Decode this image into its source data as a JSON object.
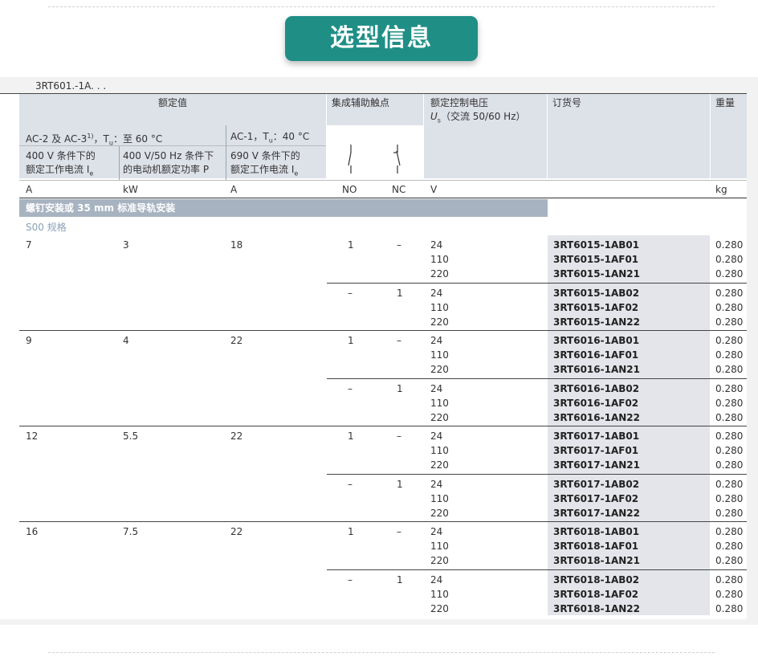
{
  "page_title": "选型信息",
  "series_code": "3RT601.-1A. . .",
  "header": {
    "rated_values": "额定值",
    "aux_contacts": "集成辅助触点",
    "control_voltage_line1": "额定控制电压",
    "control_voltage_line2": "U",
    "control_voltage_sub": "s",
    "control_voltage_line3": "（交流 50/60 Hz）",
    "order_no": "订货号",
    "weight": "重量",
    "ac2_label": "AC-2 及 AC-3",
    "ac2_sup": "1)",
    "ac2_tail": "，T",
    "ac2_tsub": "u",
    "ac2_temp": "：至 60 °C",
    "ac1_label": "AC-1，T",
    "ac1_tsub": "u",
    "ac1_temp": "：40 °C",
    "col1_line1": "400 V 条件下的",
    "col1_line2": "额定工作电流 I",
    "col1_sub": "e",
    "col2_line1": "400 V/50 Hz 条件下",
    "col2_line2": "的电动机额定功率 P",
    "col3_line1": "690 V 条件下的",
    "col3_line2": "额定工作电流 I",
    "col3_sub": "e",
    "unit_a1": "A",
    "unit_kw": "kW",
    "unit_a2": "A",
    "unit_no": "NO",
    "unit_nc": "NC",
    "unit_v": "V",
    "unit_kg": "kg"
  },
  "section_title": "螺钉安装或 35 mm 标准导轨安装",
  "size_label": "S00 规格",
  "groups": [
    {
      "current": "7",
      "power": "3",
      "ac1": "18",
      "rows": [
        {
          "no": "1",
          "nc": "–",
          "voltages": [
            "24",
            "110",
            "220"
          ],
          "orders": [
            "3RT6015-1AB01",
            "3RT6015-1AF01",
            "3RT6015-1AN21"
          ],
          "weights": [
            "0.280",
            "0.280",
            "0.280"
          ]
        },
        {
          "no": "–",
          "nc": "1",
          "voltages": [
            "24",
            "110",
            "220"
          ],
          "orders": [
            "3RT6015-1AB02",
            "3RT6015-1AF02",
            "3RT6015-1AN22"
          ],
          "weights": [
            "0.280",
            "0.280",
            "0.280"
          ]
        }
      ]
    },
    {
      "current": "9",
      "power": "4",
      "ac1": "22",
      "rows": [
        {
          "no": "1",
          "nc": "–",
          "voltages": [
            "24",
            "110",
            "220"
          ],
          "orders": [
            "3RT6016-1AB01",
            "3RT6016-1AF01",
            "3RT6016-1AN21"
          ],
          "weights": [
            "0.280",
            "0.280",
            "0.280"
          ]
        },
        {
          "no": "–",
          "nc": "1",
          "voltages": [
            "24",
            "110",
            "220"
          ],
          "orders": [
            "3RT6016-1AB02",
            "3RT6016-1AF02",
            "3RT6016-1AN22"
          ],
          "weights": [
            "0.280",
            "0.280",
            "0.280"
          ]
        }
      ]
    },
    {
      "current": "12",
      "power": "5.5",
      "ac1": "22",
      "rows": [
        {
          "no": "1",
          "nc": "–",
          "voltages": [
            "24",
            "110",
            "220"
          ],
          "orders": [
            "3RT6017-1AB01",
            "3RT6017-1AF01",
            "3RT6017-1AN21"
          ],
          "weights": [
            "0.280",
            "0.280",
            "0.280"
          ]
        },
        {
          "no": "–",
          "nc": "1",
          "voltages": [
            "24",
            "110",
            "220"
          ],
          "orders": [
            "3RT6017-1AB02",
            "3RT6017-1AF02",
            "3RT6017-1AN22"
          ],
          "weights": [
            "0.280",
            "0.280",
            "0.280"
          ]
        }
      ]
    },
    {
      "current": "16",
      "power": "7.5",
      "ac1": "22",
      "rows": [
        {
          "no": "1",
          "nc": "–",
          "voltages": [
            "24",
            "110",
            "220"
          ],
          "orders": [
            "3RT6018-1AB01",
            "3RT6018-1AF01",
            "3RT6018-1AN21"
          ],
          "weights": [
            "0.280",
            "0.280",
            "0.280"
          ]
        },
        {
          "no": "–",
          "nc": "1",
          "voltages": [
            "24",
            "110",
            "220"
          ],
          "orders": [
            "3RT6018-1AB02",
            "3RT6018-1AF02",
            "3RT6018-1AN22"
          ],
          "weights": [
            "0.280",
            "0.280",
            "0.280"
          ]
        }
      ]
    }
  ]
}
